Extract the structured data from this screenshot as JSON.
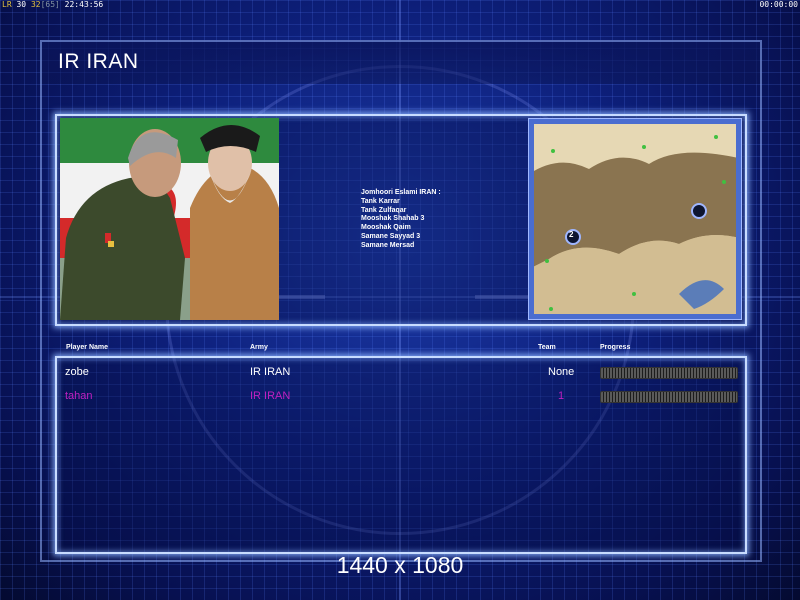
{
  "status_bar": {
    "left_prefix": "LR",
    "left_a": "30",
    "left_b": "32",
    "left_bracket": "[65]",
    "clock": "22:43:56",
    "right_timer": "00:00:00"
  },
  "screen_title": "IR IRAN",
  "faction_description": [
    "Jomhoori Eslami IRAN :",
    "Tank Karrar",
    "Tank Zulfaqar",
    "Mooshak Shahab 3",
    "Mooshak Qaim",
    "Samane Sayyad 3",
    "Samane Mersad"
  ],
  "minimap": {
    "start_positions": [
      "2",
      ""
    ]
  },
  "player_table": {
    "headers": {
      "player_name": "Player Name",
      "army": "Army",
      "team": "Team",
      "progress": "Progress"
    },
    "rows": [
      {
        "name": "zobe",
        "army": "IR IRAN",
        "team": "None",
        "color": "#ffffff"
      },
      {
        "name": "tahan",
        "army": "IR IRAN",
        "team": "1",
        "color": "#c020c0"
      }
    ]
  },
  "resolution_label": "1440 x 1080",
  "icons": [
    "portrait-image",
    "minimap-image",
    "start-position-marker",
    "progress-bar"
  ],
  "colors": {
    "background": "#0d1f7a",
    "panel_glow": "#c8dcff",
    "player_white": "#ffffff",
    "player_magenta": "#c020c0"
  }
}
